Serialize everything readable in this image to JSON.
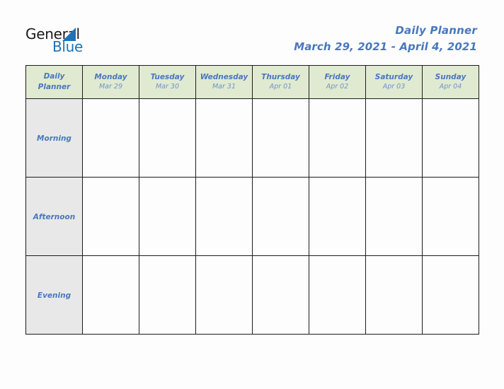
{
  "brand": {
    "logo_word_1": "General",
    "logo_word_2": "Blue",
    "triangle_icon": "triangle-icon",
    "triangle_color": "#1f72b8",
    "word_1_color": "#1a1a1a"
  },
  "header": {
    "title": "Daily Planner",
    "subtitle": "March 29, 2021 - April 4, 2021",
    "accent_color": "#4a77bd"
  },
  "table": {
    "corner_label_line1": "Daily",
    "corner_label_line2": "Planner",
    "header_background": "#e0ead1",
    "row_label_background": "#e8e8e8",
    "cell_background": "#fdfdfd",
    "border_color": "#1c1c1c",
    "columns": [
      {
        "day": "Monday",
        "date": "Mar 29"
      },
      {
        "day": "Tuesday",
        "date": "Mar 30"
      },
      {
        "day": "Wednesday",
        "date": "Mar 31"
      },
      {
        "day": "Thursday",
        "date": "Apr 01"
      },
      {
        "day": "Friday",
        "date": "Apr 02"
      },
      {
        "day": "Saturday",
        "date": "Apr 03"
      },
      {
        "day": "Sunday",
        "date": "Apr 04"
      }
    ],
    "rows": [
      {
        "label": "Morning",
        "cells": [
          "",
          "",
          "",
          "",
          "",
          "",
          ""
        ]
      },
      {
        "label": "Afternoon",
        "cells": [
          "",
          "",
          "",
          "",
          "",
          "",
          ""
        ]
      },
      {
        "label": "Evening",
        "cells": [
          "",
          "",
          "",
          "",
          "",
          "",
          ""
        ]
      }
    ]
  }
}
